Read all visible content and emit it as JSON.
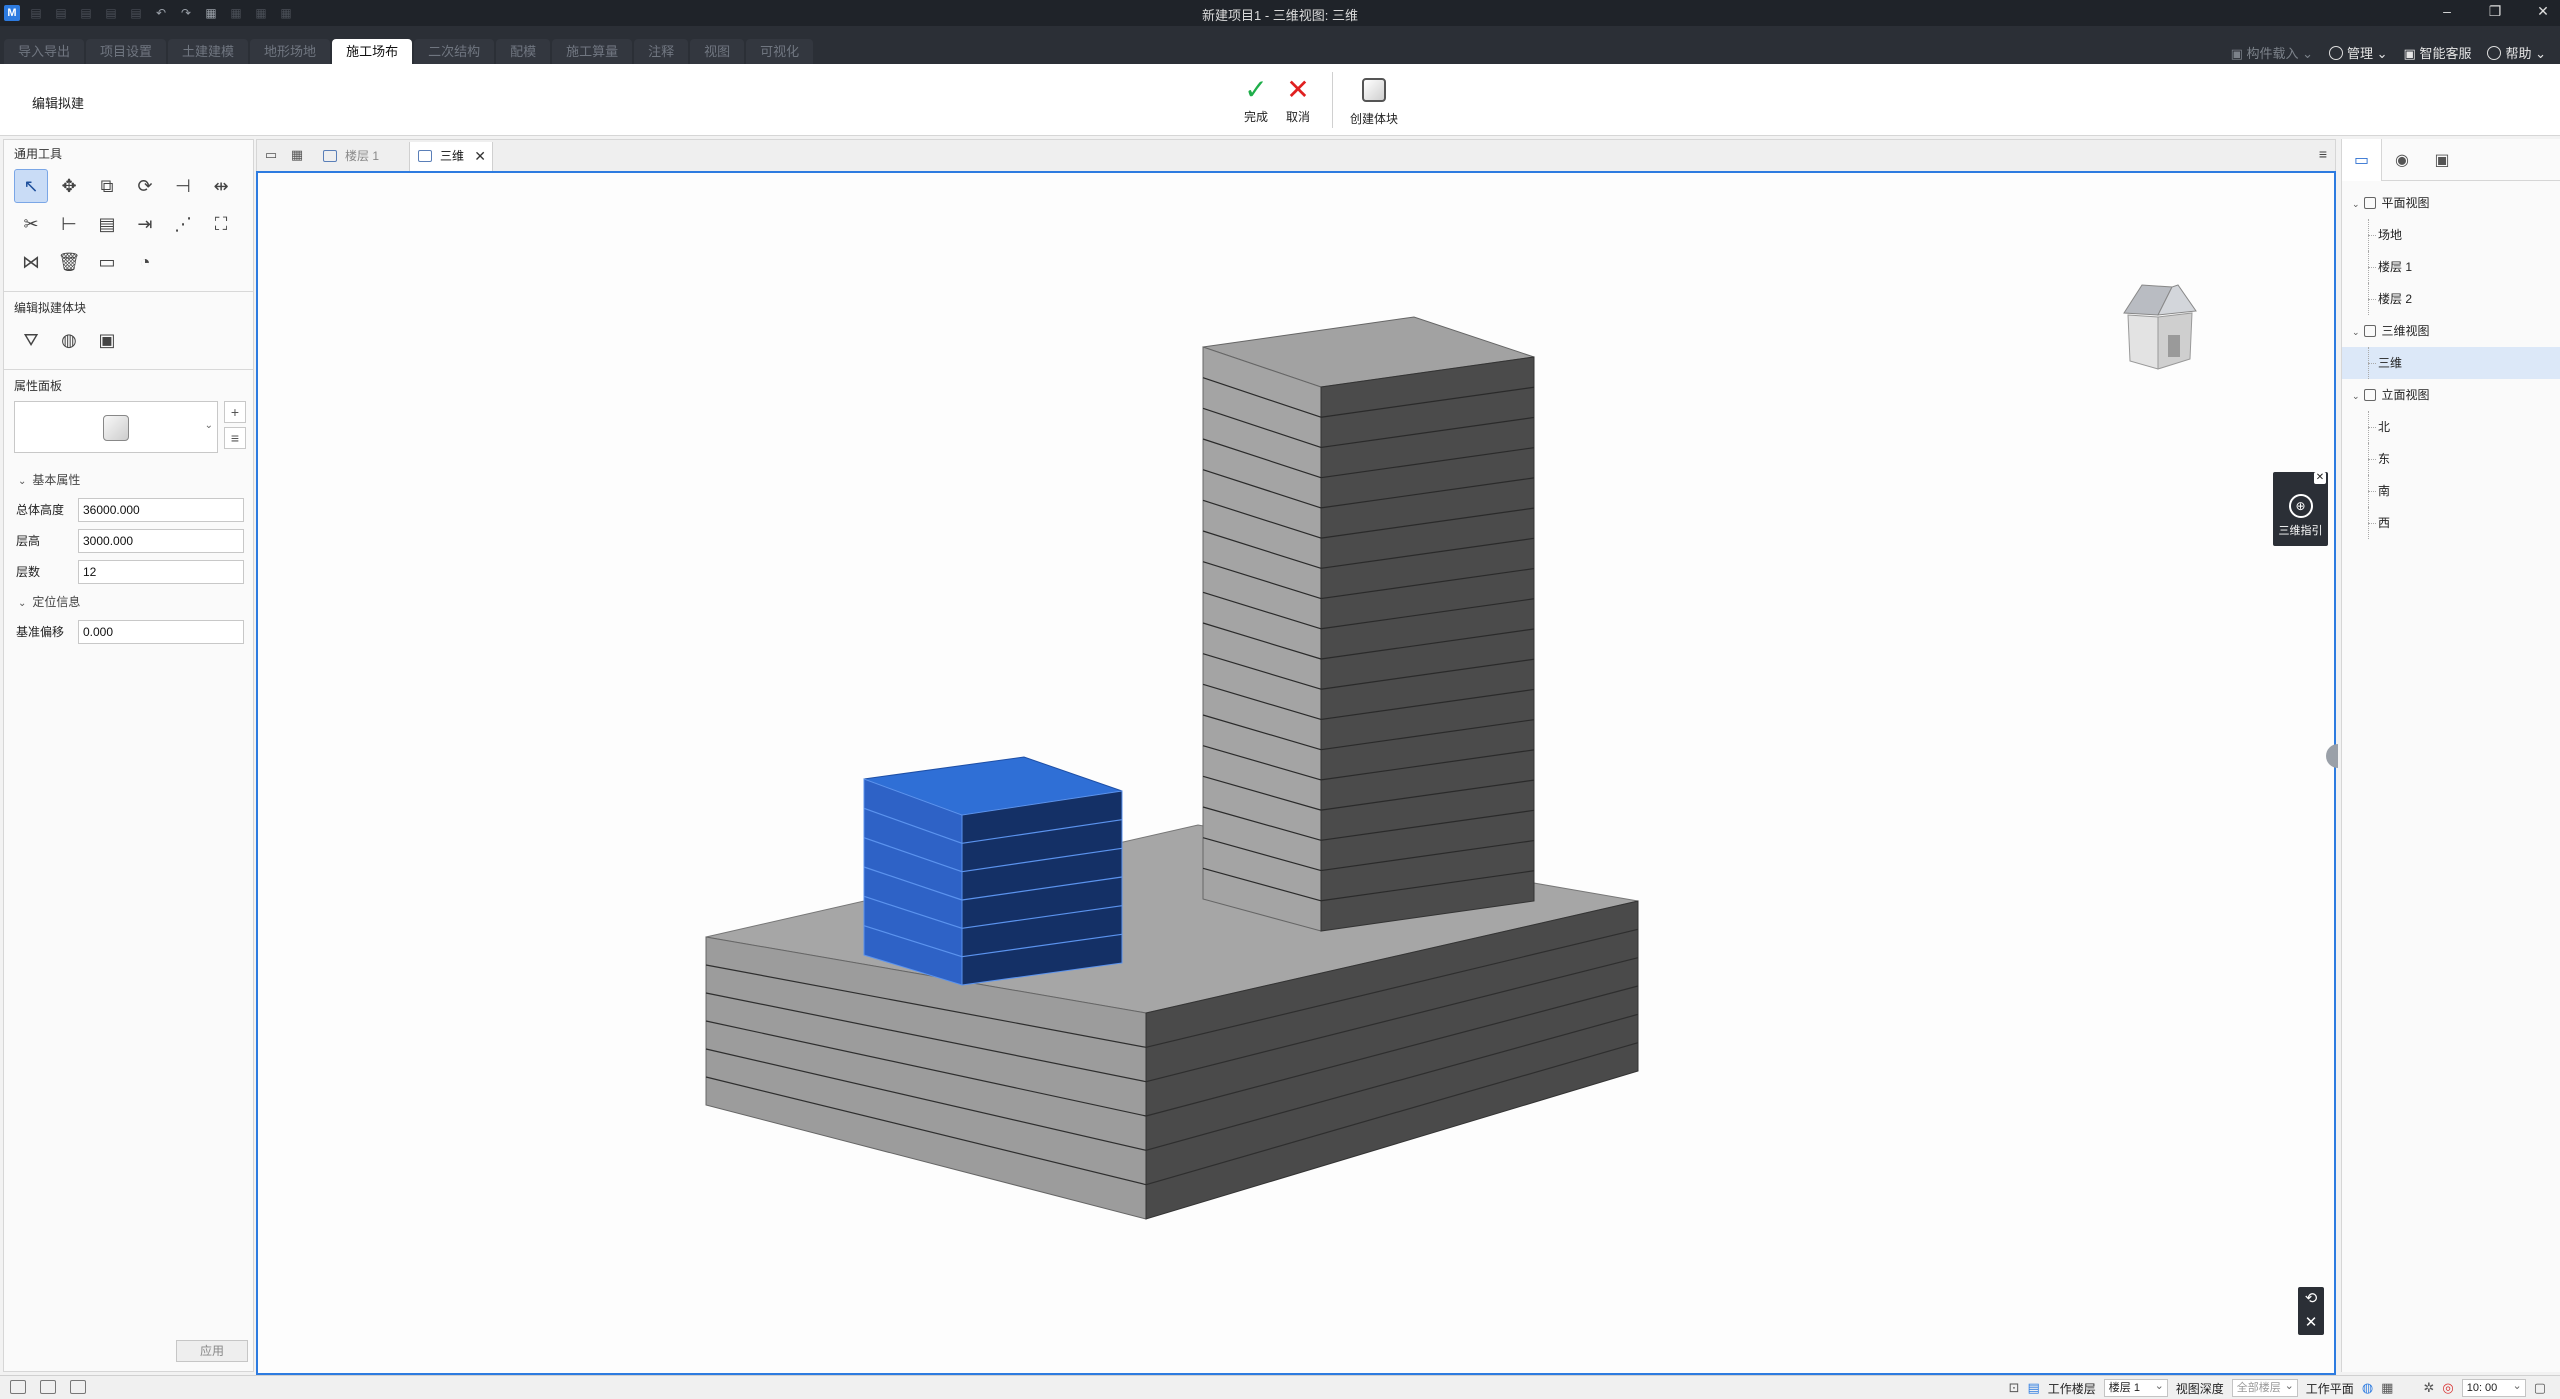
{
  "window": {
    "title": "新建项目1 - 三维视图: 三维",
    "min": "–",
    "restore": "❐",
    "close": "✕"
  },
  "ribbon": {
    "tabs": [
      "导入导出",
      "项目设置",
      "土建建模",
      "地形场地",
      "施工场布",
      "二次结构",
      "配模",
      "施工算量",
      "注释",
      "视图",
      "可视化"
    ],
    "active_tab": "施工场布",
    "right": {
      "component_load": "构件载入",
      "manage": "管理",
      "support": "智能客服",
      "help": "帮助"
    },
    "mode_label": "编辑拟建",
    "finish": "完成",
    "cancel": "取消",
    "create_volume": "创建体块"
  },
  "left_panel": {
    "general_tools_title": "通用工具",
    "edit_block_title": "编辑拟建体块",
    "property_panel_title": "属性面板",
    "basic_group": "基本属性",
    "location_group": "定位信息",
    "props": [
      {
        "name": "总体高度",
        "value": "36000.000"
      },
      {
        "name": "层高",
        "value": "3000.000"
      },
      {
        "name": "层数",
        "value": "12"
      }
    ],
    "location_props": [
      {
        "name": "基准偏移",
        "value": "0.000"
      }
    ],
    "apply": "应用"
  },
  "view_tabs": {
    "inactive": "楼层 1",
    "active": "三维",
    "close": "✕",
    "menu": "≡"
  },
  "guide": {
    "label": "三维指引",
    "close": "✕"
  },
  "nav_controls": {
    "reset": "⟲",
    "close": "✕"
  },
  "right_panel": {
    "groups": [
      {
        "label": "平面视图",
        "children": [
          "场地",
          "楼层 1",
          "楼层 2"
        ]
      },
      {
        "label": "三维视图",
        "children": [
          "三维"
        ]
      },
      {
        "label": "立面视图",
        "children": [
          "北",
          "东",
          "南",
          "西"
        ]
      }
    ],
    "selected": "三维"
  },
  "status_bar": {
    "work_floor_label": "工作楼层",
    "work_floor_value": "楼层 1",
    "view_depth_label": "视图深度",
    "view_depth_value": "全部楼层",
    "work_plane_label": "工作平面",
    "scale_value": "10: 00"
  },
  "colors": {
    "accent": "#2d7be0",
    "selected_block": "#2f6fd6",
    "building_dark": "#4a4a4a",
    "building_light": "#9a9a9a",
    "finish_green": "#1fae4a",
    "cancel_red": "#e02020"
  }
}
